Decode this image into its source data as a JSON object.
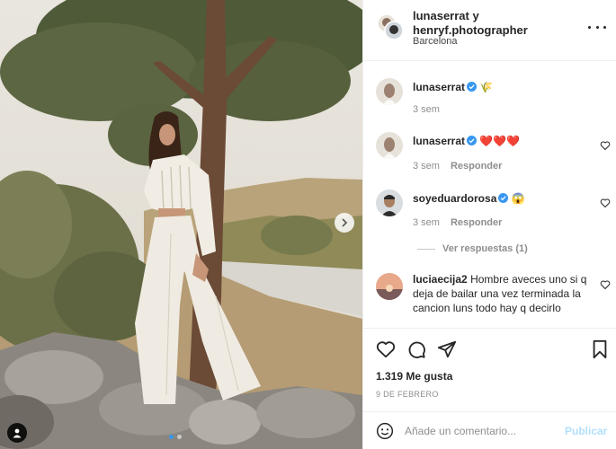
{
  "header": {
    "names": "lunaserrat y henryf.photographer",
    "location": "Barcelona"
  },
  "comments": [
    {
      "username": "lunaserrat",
      "text": "🌾",
      "time": "3 sem",
      "reply": ""
    },
    {
      "username": "lunaserrat",
      "text": "❤️❤️❤️",
      "time": "3 sem",
      "reply": "Responder"
    },
    {
      "username": "soyeduardorosa",
      "text": "😱",
      "time": "3 sem",
      "reply": "Responder"
    },
    {
      "username": "luciaecija2",
      "text": "Hombre aveces uno si q deja de bailar una vez terminada la cancion luns todo hay q decirlo"
    }
  ],
  "view_replies": "Ver respuestas (1)",
  "likes": "1.319 Me gusta",
  "date": "9 DE FEBRERO",
  "composer": {
    "placeholder": "Añade un comentario...",
    "publish": "Publicar"
  },
  "icons": {
    "verified": "verified-badge-icon",
    "like": "heart-icon",
    "comment": "comment-icon",
    "share": "paper-plane-icon",
    "save": "bookmark-icon",
    "more": "ellipsis-icon",
    "next": "chevron-right-icon",
    "tag": "user-tag-icon",
    "emoji": "smiley-icon"
  },
  "colors": {
    "verified": "#3897f0",
    "publish_disabled": "#b2dffc",
    "secondary_text": "#8e8e8e"
  }
}
